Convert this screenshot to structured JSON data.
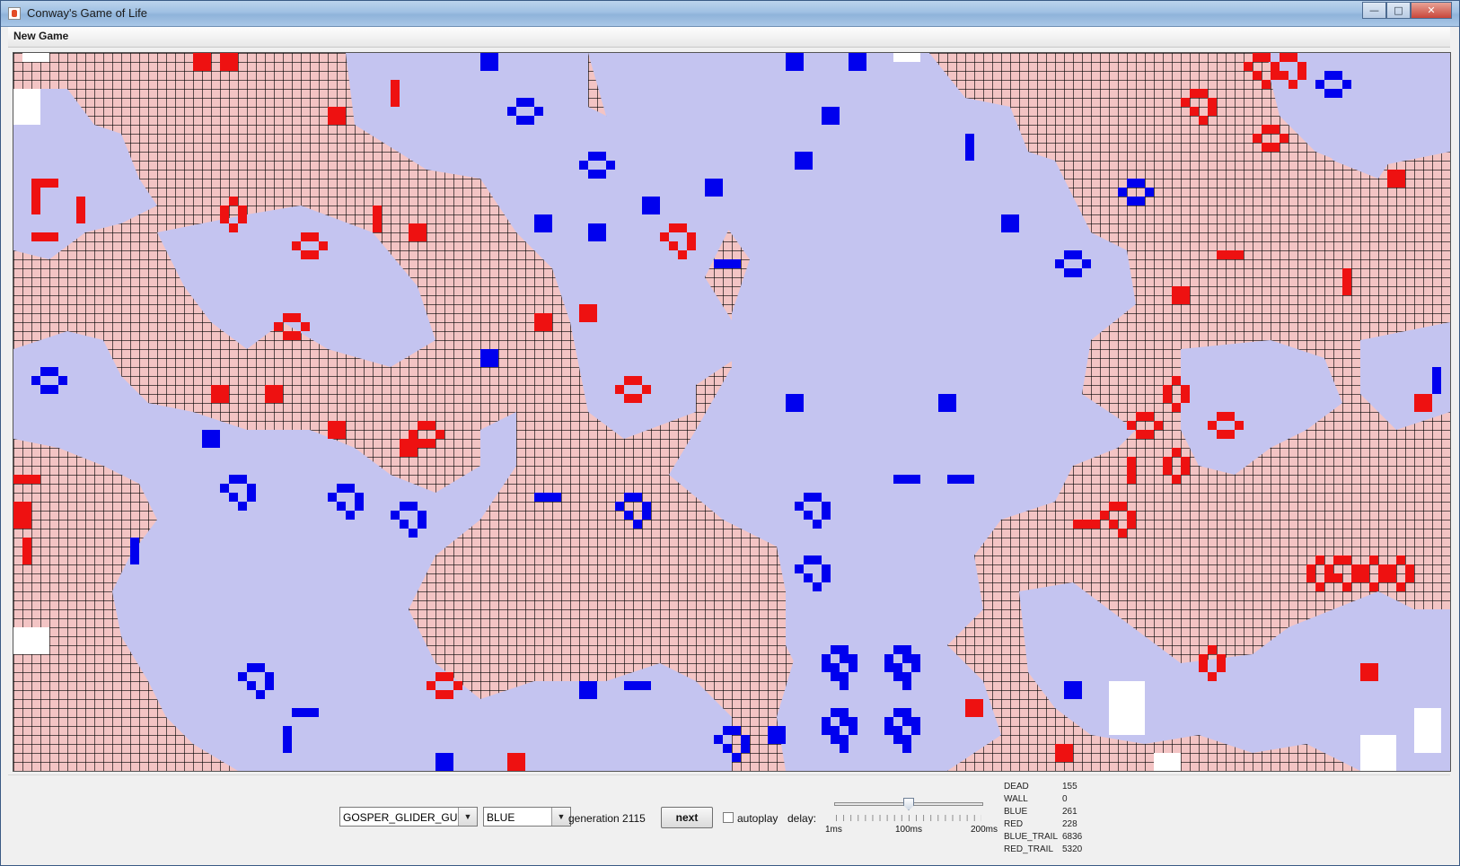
{
  "window": {
    "title": "Conway's Game of Life",
    "controls": {
      "minimize": "—",
      "maximize": "□",
      "close": "✕"
    }
  },
  "menu": {
    "new_game": "New Game"
  },
  "board": {
    "colors": {
      "dead": "#ffffff",
      "wall": "#000000",
      "blue": "#0000ee",
      "red": "#ee1111",
      "blue_trail": "#c4c4f0",
      "red_trail": "#f3c4c4",
      "grid": "#000000"
    }
  },
  "controls": {
    "pattern_select": "GOSPER_GLIDER_GUN",
    "team_select": "BLUE",
    "generation_label": "generation 2115",
    "next_button": "next",
    "autoplay_label": "autoplay",
    "autoplay_checked": false,
    "delay_label": "delay:",
    "delay_value_ms": 100,
    "delay_ticks": {
      "min": "1ms",
      "mid": "100ms",
      "max": "200ms"
    }
  },
  "stats": [
    {
      "name": "DEAD",
      "value": "155"
    },
    {
      "name": "WALL",
      "value": "0"
    },
    {
      "name": "BLUE",
      "value": "261"
    },
    {
      "name": "RED",
      "value": "228"
    },
    {
      "name": "BLUE_TRAIL",
      "value": "6836"
    },
    {
      "name": "RED_TRAIL",
      "value": "5320"
    }
  ]
}
